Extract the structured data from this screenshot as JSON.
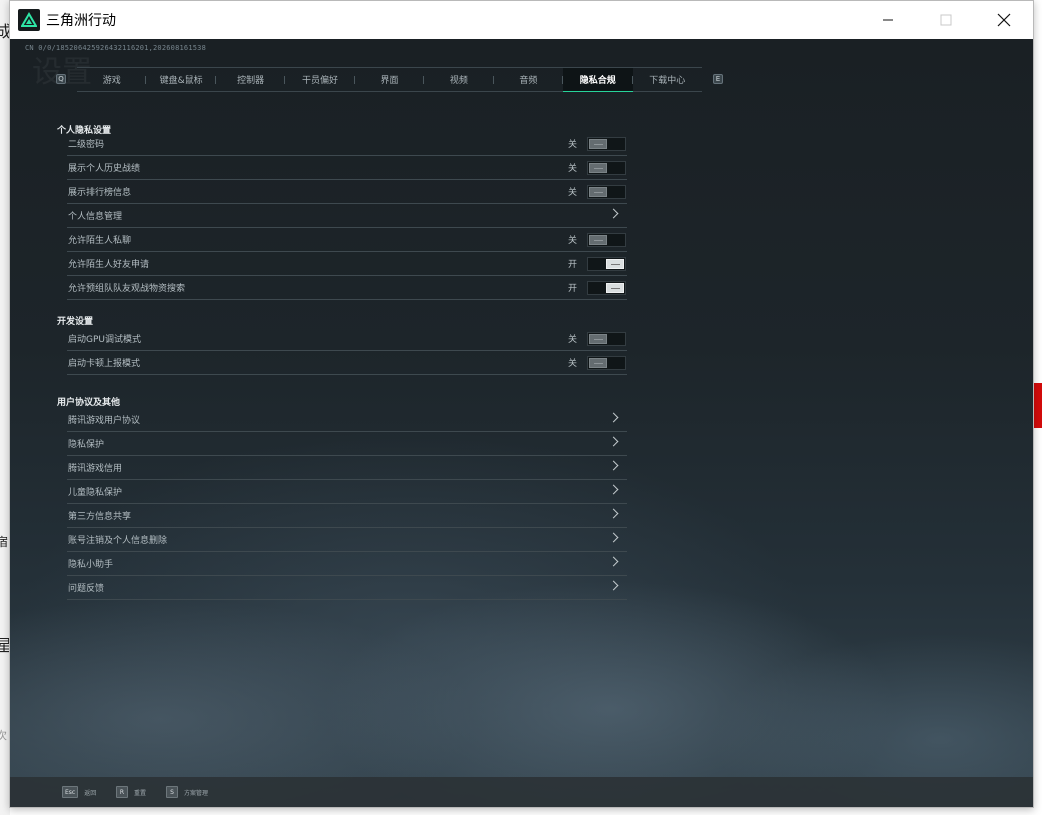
{
  "window": {
    "title": "三角洲行动",
    "build_id": "CN 0/0/185206425926432116201,202608161538",
    "watermark": "设置"
  },
  "background_app": {
    "edge_glyphs": [
      "成",
      "宿",
      "星",
      "次"
    ]
  },
  "tabs": {
    "left_key": "Q",
    "right_key": "E",
    "items": [
      {
        "label": "游戏",
        "active": false
      },
      {
        "label": "键盘&鼠标",
        "active": false
      },
      {
        "label": "控制器",
        "active": false
      },
      {
        "label": "干员偏好",
        "active": false
      },
      {
        "label": "界面",
        "active": false
      },
      {
        "label": "视频",
        "active": false
      },
      {
        "label": "音频",
        "active": false
      },
      {
        "label": "隐私合规",
        "active": true
      },
      {
        "label": "下载中心",
        "active": false
      }
    ]
  },
  "sections": {
    "privacy": {
      "title": "个人隐私设置",
      "rows": [
        {
          "label": "二级密码",
          "type": "toggle",
          "status": "关",
          "on": false
        },
        {
          "label": "展示个人历史战绩",
          "type": "toggle",
          "status": "关",
          "on": false
        },
        {
          "label": "展示排行榜信息",
          "type": "toggle",
          "status": "关",
          "on": false
        },
        {
          "label": "个人信息管理",
          "type": "link"
        },
        {
          "label": "允许陌生人私聊",
          "type": "toggle",
          "status": "关",
          "on": false
        },
        {
          "label": "允许陌生人好友申请",
          "type": "toggle",
          "status": "开",
          "on": true
        },
        {
          "label": "允许预组队队友观战物资搜索",
          "type": "toggle",
          "status": "开",
          "on": true
        }
      ]
    },
    "dev": {
      "title": "开发设置",
      "rows": [
        {
          "label": "启动GPU调试模式",
          "type": "toggle",
          "status": "关",
          "on": false
        },
        {
          "label": "启动卡顿上报模式",
          "type": "toggle",
          "status": "关",
          "on": false
        }
      ]
    },
    "agreements": {
      "title": "用户协议及其他",
      "rows": [
        {
          "label": "腾讯游戏用户协议",
          "type": "link"
        },
        {
          "label": "隐私保护",
          "type": "link"
        },
        {
          "label": "腾讯游戏信用",
          "type": "link"
        },
        {
          "label": "儿童隐私保护",
          "type": "link"
        },
        {
          "label": "第三方信息共享",
          "type": "link"
        },
        {
          "label": "账号注销及个人信息删除",
          "type": "link"
        },
        {
          "label": "隐私小助手",
          "type": "link"
        },
        {
          "label": "问题反馈",
          "type": "link"
        }
      ]
    }
  },
  "bottom_bar": {
    "hints": [
      {
        "key": "Esc",
        "label": "返回"
      },
      {
        "key": "R",
        "label": "重置"
      },
      {
        "key": "S",
        "label": "方案管理"
      }
    ]
  },
  "colors": {
    "accent": "#27d39a",
    "panel_bg": "#1d252a"
  }
}
